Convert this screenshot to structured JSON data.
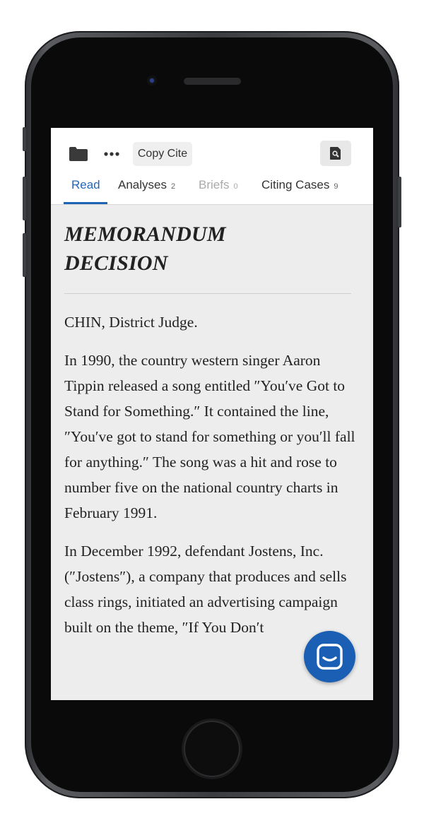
{
  "toolbar": {
    "folder_icon": "folder-icon",
    "more_icon": "more-icon",
    "copy_cite_label": "Copy Cite",
    "search_icon": "search-document-icon"
  },
  "tabs": [
    {
      "label": "Read",
      "count": "",
      "state": "active"
    },
    {
      "label": "Analyses",
      "count": "2",
      "state": "normal"
    },
    {
      "label": "Briefs",
      "count": "0",
      "state": "disabled"
    },
    {
      "label": "Citing Cases",
      "count": "9",
      "state": "normal"
    }
  ],
  "document": {
    "heading_line1": "MEMORANDUM",
    "heading_line2": "DECISION",
    "paragraphs": [
      "CHIN, District Judge.",
      "In 1990, the country western singer Aaron Tippin released a song entitled ″You′ve Got to Stand for Something.″ It contained the line, ″You′ve got to stand for something or you′ll fall for anything.″ The song was a hit and rose to number five on the national country charts in February 1991.",
      "In December 1992, defendant Jostens, Inc. (″Jostens″), a company that produces and sells class rings, initiated an advertising campaign built on the theme, ″If You Don′t"
    ]
  },
  "chat": {
    "icon": "chat-icon"
  },
  "colors": {
    "accent": "#1f63b4",
    "chat_bg": "#1a5fb4",
    "screen_bg": "#ededed"
  }
}
